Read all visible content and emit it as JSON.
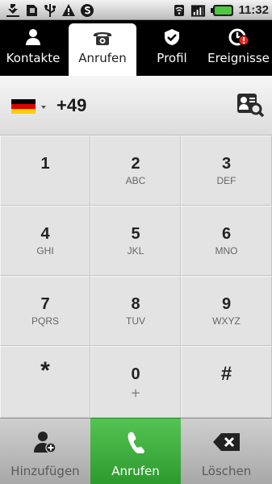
{
  "status_bar": {
    "left_icons": [
      "download-done-icon",
      "sd-card-icon",
      "usb-icon",
      "warning-icon",
      "skype-icon"
    ],
    "right_icons": [
      "wifi-icon",
      "signal-icon",
      "battery-icon"
    ],
    "time": "11:32"
  },
  "tabs": [
    {
      "label": "Kontakte",
      "icon": "contacts-icon"
    },
    {
      "label": "Anrufen",
      "icon": "phone-icon",
      "active": true
    },
    {
      "label": "Profil",
      "icon": "profile-icon"
    },
    {
      "label": "Ereignisse",
      "icon": "events-icon"
    }
  ],
  "number_bar": {
    "country_code": "+49",
    "flag": "germany-flag-icon",
    "flag_colors": [
      "#000000",
      "#dd0000",
      "#ffce00"
    ]
  },
  "keypad": [
    {
      "digit": "1",
      "letters": ""
    },
    {
      "digit": "2",
      "letters": "ABC"
    },
    {
      "digit": "3",
      "letters": "DEF"
    },
    {
      "digit": "4",
      "letters": "GHI"
    },
    {
      "digit": "5",
      "letters": "JKL"
    },
    {
      "digit": "6",
      "letters": "MNO"
    },
    {
      "digit": "7",
      "letters": "PQRS"
    },
    {
      "digit": "8",
      "letters": "TUV"
    },
    {
      "digit": "9",
      "letters": "WXYZ"
    },
    {
      "digit": "*",
      "letters": ""
    },
    {
      "digit": "0",
      "letters": "+"
    },
    {
      "digit": "#",
      "letters": ""
    }
  ],
  "actions": {
    "add": {
      "label": "Hinzufügen",
      "icon": "add-contact-icon"
    },
    "call": {
      "label": "Anrufen",
      "icon": "phone-handset-icon"
    },
    "delete": {
      "label": "Löschen",
      "icon": "backspace-icon"
    }
  },
  "colors": {
    "tab_bar": "#000000",
    "call_green": "#3fae3f",
    "keypad_bg": "#e3e3e3",
    "event_badge": "#e8231b"
  }
}
